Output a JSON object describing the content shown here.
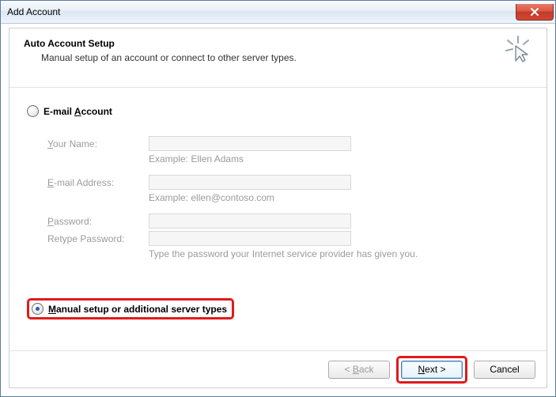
{
  "window": {
    "title": "Add Account"
  },
  "header": {
    "title": "Auto Account Setup",
    "subtitle": "Manual setup of an account or connect to other server types."
  },
  "options": {
    "email_account_label": "E-mail Account",
    "manual_setup_label": "Manual setup or additional server types"
  },
  "form": {
    "your_name_label": "Your Name:",
    "your_name_value": "",
    "your_name_example": "Example: Ellen Adams",
    "email_label": "E-mail Address:",
    "email_value": "",
    "email_example": "Example: ellen@contoso.com",
    "password_label": "Password:",
    "password_value": "",
    "retype_label": "Retype Password:",
    "retype_value": "",
    "password_hint": "Type the password your Internet service provider has given you."
  },
  "buttons": {
    "back": "< Back",
    "next": "Next >",
    "cancel": "Cancel"
  }
}
